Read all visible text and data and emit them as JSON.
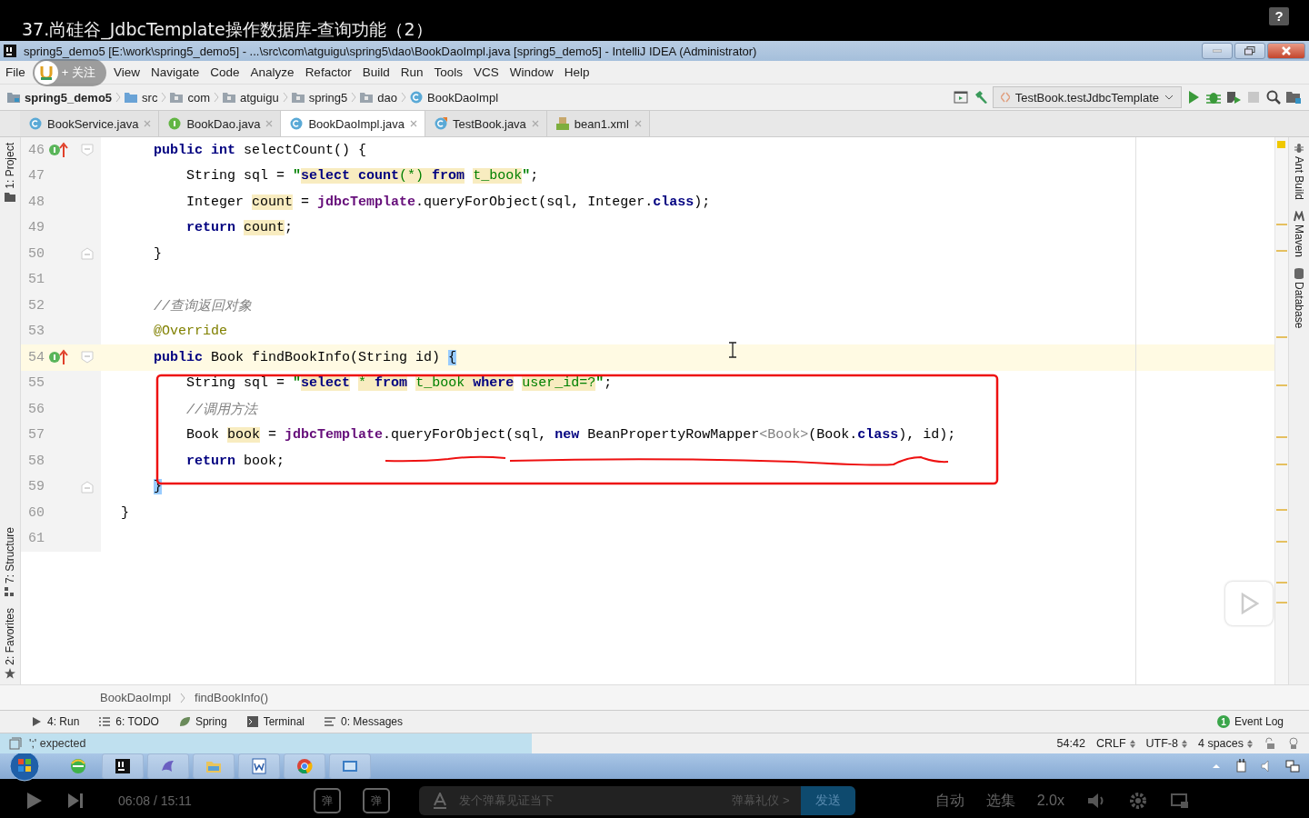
{
  "video": {
    "title": "37.尚硅谷_JdbcTemplate操作数据库-查询功能（2）",
    "help": "?"
  },
  "window": {
    "title": "spring5_demo5 [E:\\work\\spring5_demo5] - ...\\src\\com\\atguigu\\spring5\\dao\\BookDaoImpl.java [spring5_demo5] - IntelliJ IDEA (Administrator)"
  },
  "follow_badge": {
    "label": "+ 关注"
  },
  "menu": [
    "File",
    "View",
    "Navigate",
    "Code",
    "Analyze",
    "Refactor",
    "Build",
    "Run",
    "Tools",
    "VCS",
    "Window",
    "Help"
  ],
  "nav": [
    {
      "label": "spring5_demo5",
      "kind": "project"
    },
    {
      "label": "src",
      "kind": "source"
    },
    {
      "label": "com",
      "kind": "package"
    },
    {
      "label": "atguigu",
      "kind": "package"
    },
    {
      "label": "spring5",
      "kind": "package"
    },
    {
      "label": "dao",
      "kind": "package"
    },
    {
      "label": "BookDaoImpl",
      "kind": "class"
    }
  ],
  "run_config": "TestBook.testJdbcTemplate",
  "tabs": [
    {
      "label": "BookService.java",
      "kind": "class",
      "selected": false
    },
    {
      "label": "BookDao.java",
      "kind": "interface",
      "selected": false
    },
    {
      "label": "BookDaoImpl.java",
      "kind": "class",
      "selected": true
    },
    {
      "label": "TestBook.java",
      "kind": "test",
      "selected": false
    },
    {
      "label": "bean1.xml",
      "kind": "xml",
      "selected": false
    }
  ],
  "left_tools": [
    {
      "label": "1: Project",
      "kind": "project"
    },
    {
      "label": "7: Structure",
      "kind": "structure"
    },
    {
      "label": "2: Favorites",
      "kind": "favorites"
    }
  ],
  "right_tools": [
    {
      "label": "Ant Build",
      "kind": "ant"
    },
    {
      "label": "Maven",
      "kind": "maven"
    },
    {
      "label": "Database",
      "kind": "database"
    }
  ],
  "code": [
    {
      "number": "46",
      "implements": true,
      "current": false,
      "fold_start": true,
      "fold_end": false,
      "tokens": [
        {
          "text": "    public ",
          "kind": "keyword"
        },
        {
          "text": "int",
          "kind": "keyword"
        },
        {
          "text": " selectCount() {",
          "kind": "plain"
        }
      ]
    },
    {
      "number": "47",
      "implements": false,
      "current": false,
      "fold_start": false,
      "fold_end": false,
      "tokens": [
        {
          "text": "        String sql = ",
          "kind": "plain"
        },
        {
          "text": "\"",
          "kind": "string"
        },
        {
          "text": "select count",
          "kind": "sql"
        },
        {
          "text": "(*) ",
          "kind": "sqltext"
        },
        {
          "text": "from",
          "kind": "sql"
        },
        {
          "text": " t_book",
          "kind": "sqltext"
        },
        {
          "text": "\"",
          "kind": "string"
        },
        {
          "text": ";",
          "kind": "plain"
        }
      ]
    },
    {
      "number": "48",
      "implements": false,
      "current": false,
      "fold_start": false,
      "fold_end": false,
      "tokens": [
        {
          "text": "        Integer ",
          "kind": "plain"
        },
        {
          "text": "count",
          "kind": "usage"
        },
        {
          "text": " = ",
          "kind": "plain"
        },
        {
          "text": "jdbcTemplate",
          "kind": "field"
        },
        {
          "text": ".queryForObject(sql, Integer.",
          "kind": "plain"
        },
        {
          "text": "class",
          "kind": "keyword"
        },
        {
          "text": ");",
          "kind": "plain"
        }
      ]
    },
    {
      "number": "49",
      "implements": false,
      "current": false,
      "fold_start": false,
      "fold_end": false,
      "tokens": [
        {
          "text": "        return ",
          "kind": "keyword"
        },
        {
          "text": "count",
          "kind": "usage"
        },
        {
          "text": ";",
          "kind": "plain"
        }
      ]
    },
    {
      "number": "50",
      "implements": false,
      "current": false,
      "fold_start": false,
      "fold_end": true,
      "tokens": [
        {
          "text": "    }",
          "kind": "plain"
        }
      ]
    },
    {
      "number": "51",
      "implements": false,
      "current": false,
      "fold_start": false,
      "fold_end": false
    },
    {
      "number": "52",
      "implements": false,
      "current": false,
      "fold_start": false,
      "fold_end": false,
      "tokens": [
        {
          "text": "    //查询返回对象",
          "kind": "comment"
        }
      ]
    },
    {
      "number": "53",
      "implements": false,
      "current": false,
      "fold_start": false,
      "fold_end": false,
      "tokens": [
        {
          "text": "    @Override",
          "kind": "annotation"
        }
      ]
    },
    {
      "number": "54",
      "implements": true,
      "current": true,
      "fold_start": true,
      "fold_end": false,
      "tokens": [
        {
          "text": "    public",
          "kind": "keyword"
        },
        {
          "text": " Book findBookInfo(String id) ",
          "kind": "plain"
        },
        {
          "text": "{",
          "kind": "brace"
        }
      ]
    },
    {
      "number": "55",
      "implements": false,
      "current": false,
      "fold_start": false,
      "fold_end": false,
      "tokens": [
        {
          "text": "        String sql = ",
          "kind": "plain"
        },
        {
          "text": "\"",
          "kind": "string"
        },
        {
          "text": "select",
          "kind": "sql"
        },
        {
          "text": " * ",
          "kind": "sqltext"
        },
        {
          "text": "from",
          "kind": "sql"
        },
        {
          "text": " t_book ",
          "kind": "sqltext"
        },
        {
          "text": "where",
          "kind": "sql"
        },
        {
          "text": " user_id=?",
          "kind": "sqltext"
        },
        {
          "text": "\"",
          "kind": "string"
        },
        {
          "text": ";",
          "kind": "plain"
        }
      ]
    },
    {
      "number": "56",
      "implements": false,
      "current": false,
      "fold_start": false,
      "fold_end": false,
      "tokens": [
        {
          "text": "        //调用方法",
          "kind": "comment"
        }
      ]
    },
    {
      "number": "57",
      "implements": false,
      "current": false,
      "fold_start": false,
      "fold_end": false,
      "tokens": [
        {
          "text": "        Book ",
          "kind": "plain"
        },
        {
          "text": "book",
          "kind": "usage"
        },
        {
          "text": " = ",
          "kind": "plain"
        },
        {
          "text": "jdbcTemplate",
          "kind": "field"
        },
        {
          "text": ".queryForObject(sql, ",
          "kind": "plain"
        },
        {
          "text": "new",
          "kind": "keyword"
        },
        {
          "text": " BeanPropertyRowMapper",
          "kind": "plain"
        },
        {
          "text": "<Book>",
          "kind": "generic"
        },
        {
          "text": "(Book.",
          "kind": "plain"
        },
        {
          "text": "class",
          "kind": "keyword"
        },
        {
          "text": "), id);",
          "kind": "plain"
        }
      ]
    },
    {
      "number": "58",
      "implements": false,
      "current": false,
      "fold_start": false,
      "fold_end": false,
      "tokens": [
        {
          "text": "        return",
          "kind": "keyword"
        },
        {
          "text": " book;",
          "kind": "plain"
        }
      ]
    },
    {
      "number": "59",
      "implements": false,
      "current": false,
      "fold_start": false,
      "fold_end": true,
      "tokens": [
        {
          "text": "    }",
          "kind": "brace"
        }
      ]
    },
    {
      "number": "60",
      "implements": false,
      "current": false,
      "fold_start": false,
      "fold_end": false,
      "tokens": [
        {
          "text": "}",
          "kind": "plain"
        }
      ]
    },
    {
      "number": "61",
      "implements": false,
      "current": false,
      "fold_start": false,
      "fold_end": false
    }
  ],
  "breadcrumb": [
    "BookDaoImpl",
    "findBookInfo()"
  ],
  "tool_windows": [
    {
      "label": "4: Run",
      "kind": "run"
    },
    {
      "label": "6: TODO",
      "kind": "todo"
    },
    {
      "label": "Spring",
      "kind": "spring"
    },
    {
      "label": "Terminal",
      "kind": "terminal"
    },
    {
      "label": "0: Messages",
      "kind": "messages"
    }
  ],
  "event_log": {
    "label": "Event Log",
    "count": "1"
  },
  "status": {
    "message": "';' expected",
    "items": [
      "54:42",
      "CRLF",
      "UTF-8",
      "4 spaces"
    ]
  },
  "progress": {
    "level": 0.406
  },
  "taskbar": [
    {
      "kind": "ie"
    },
    {
      "kind": "intellij"
    },
    {
      "kind": "dolphin"
    },
    {
      "kind": "explorer"
    },
    {
      "kind": "word"
    },
    {
      "kind": "chrome"
    },
    {
      "kind": "screen"
    }
  ],
  "player": {
    "time": "06:08 / 15:11",
    "danmaku_toggles": [
      "弹",
      "弹"
    ],
    "placeholder": "发个弹幕见证当下",
    "etiquette": "弹幕礼仪 >",
    "send": "发送",
    "options": [
      "自动",
      "选集",
      "2.0x"
    ]
  }
}
